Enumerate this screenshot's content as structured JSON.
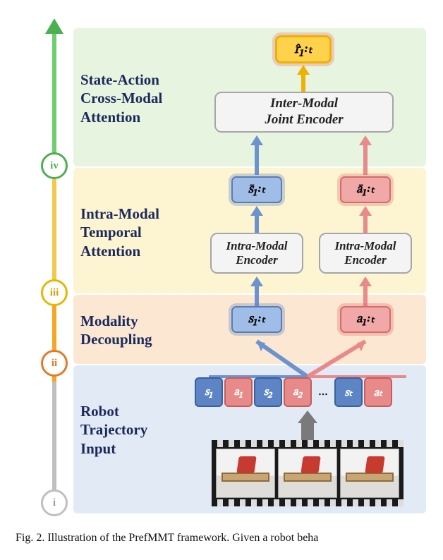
{
  "stages": {
    "iv": {
      "label": "State-Action\nCross-Modal\nAttention",
      "marker": "iv"
    },
    "iii": {
      "label": "Intra-Modal\nTemporal\nAttention",
      "marker": "iii"
    },
    "ii": {
      "label": "Modality\nDecoupling",
      "marker": "ii"
    },
    "i": {
      "label": "Robot\nTrajectory\nInput",
      "marker": "i"
    }
  },
  "output_var": "r̂₁꞉ₜ",
  "joint_encoder": "Inter-Modal\nJoint Encoder",
  "intra_encoder": "Intra-Modal\nEncoder",
  "vars": {
    "sbar": "s̄₁꞉ₜ",
    "abar": "ā₁꞉ₜ",
    "slt": "s₁꞉ₜ",
    "alt": "a₁꞉ₜ"
  },
  "tokens": [
    "s₁",
    "a₁",
    "s₂",
    "a₂",
    "…",
    "sₜ",
    "aₜ"
  ],
  "token_types": [
    "s",
    "a",
    "s",
    "a",
    "dots",
    "s",
    "a"
  ],
  "caption": "Fig. 2.   Illustration of the PrefMMT framework. Given a robot beha",
  "colors": {
    "state": "#5d85c6",
    "action": "#e98a8a",
    "output": "#ffd24d"
  }
}
